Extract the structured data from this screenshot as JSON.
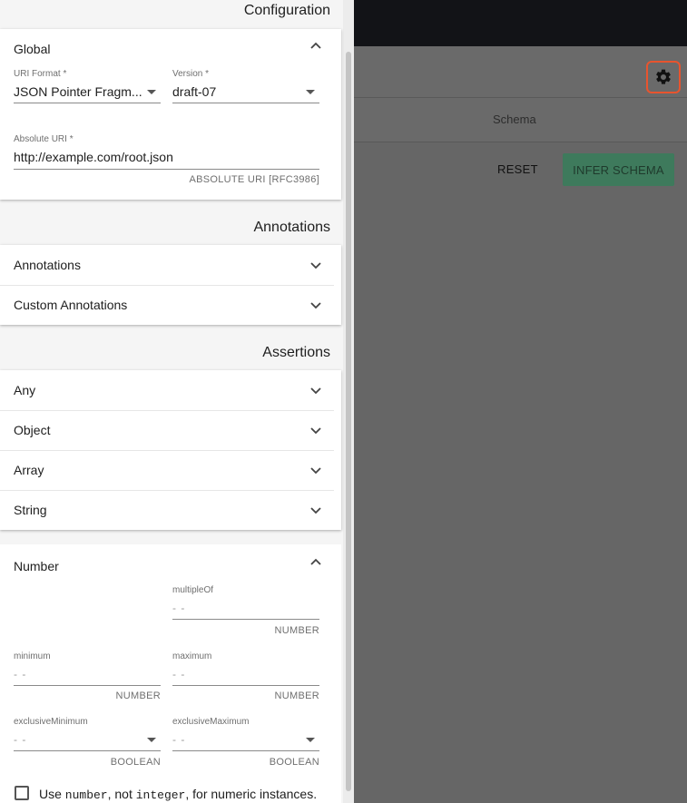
{
  "background": {
    "tab_label": "Schema",
    "reset_label": "RESET",
    "infer_label": "INFER SCHEMA",
    "gear_icon": "gear-icon"
  },
  "drawer": {
    "title": "Configuration",
    "global": {
      "header": "Global",
      "uri_format": {
        "label": "URI Format *",
        "value": "JSON Pointer Fragm..."
      },
      "version": {
        "label": "Version *",
        "value": "draft-07"
      },
      "absolute_uri": {
        "label": "Absolute URI *",
        "value": "http://example.com/root.json",
        "helper": "ABSOLUTE URI [RFC3986]"
      }
    },
    "annotations": {
      "title": "Annotations",
      "items": [
        "Annotations",
        "Custom Annotations"
      ]
    },
    "assertions": {
      "title": "Assertions",
      "items": [
        "Any",
        "Object",
        "Array",
        "String"
      ]
    },
    "number": {
      "header": "Number",
      "multipleOf": {
        "label": "multipleOf",
        "placeholder": "- -",
        "helper": "NUMBER"
      },
      "minimum": {
        "label": "minimum",
        "placeholder": "- -",
        "helper": "NUMBER"
      },
      "maximum": {
        "label": "maximum",
        "placeholder": "- -",
        "helper": "NUMBER"
      },
      "exclusiveMinimum": {
        "label": "exclusiveMinimum",
        "placeholder": "- -",
        "helper": "BOOLEAN"
      },
      "exclusiveMaximum": {
        "label": "exclusiveMaximum",
        "placeholder": "- -",
        "helper": "BOOLEAN"
      },
      "checkbox": {
        "pre": "Use ",
        "code1": "number",
        "mid": ", not ",
        "code2": "integer",
        "post": ", for numeric instances."
      }
    }
  }
}
